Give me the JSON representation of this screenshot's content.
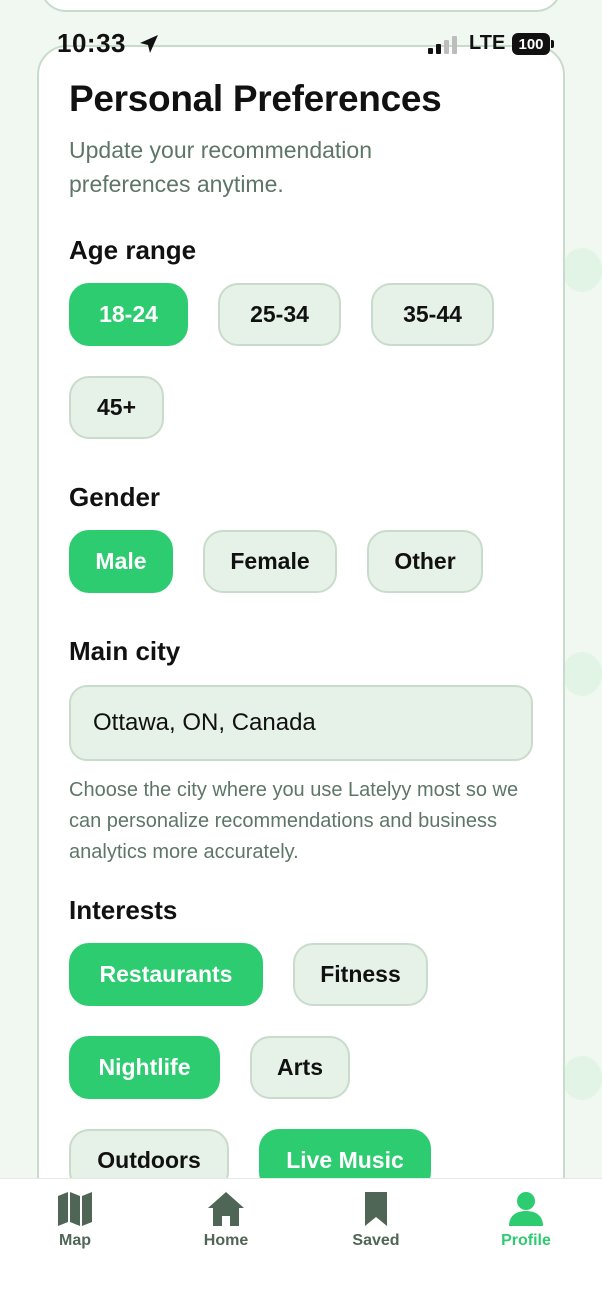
{
  "status_bar": {
    "time": "10:33",
    "network": "LTE",
    "battery": "100"
  },
  "header": {
    "title": "Personal Preferences",
    "subtitle": "Update your recommendation preferences anytime."
  },
  "age_range": {
    "label": "Age range",
    "options": [
      {
        "label": "18-24",
        "selected": true
      },
      {
        "label": "25-34",
        "selected": false
      },
      {
        "label": "35-44",
        "selected": false
      },
      {
        "label": "45+",
        "selected": false
      }
    ]
  },
  "gender": {
    "label": "Gender",
    "options": [
      {
        "label": "Male",
        "selected": true
      },
      {
        "label": "Female",
        "selected": false
      },
      {
        "label": "Other",
        "selected": false
      }
    ]
  },
  "main_city": {
    "label": "Main city",
    "value": "Ottawa, ON, Canada",
    "helper": "Choose the city where you use Latelyy most so we can personalize recommendations and business analytics more accurately."
  },
  "interests": {
    "label": "Interests",
    "options": [
      {
        "label": "Restaurants",
        "selected": true
      },
      {
        "label": "Fitness",
        "selected": false
      },
      {
        "label": "Nightlife",
        "selected": true
      },
      {
        "label": "Arts",
        "selected": false
      },
      {
        "label": "Outdoors",
        "selected": false
      },
      {
        "label": "Live Music",
        "selected": true
      }
    ]
  },
  "tab_bar": {
    "items": [
      {
        "label": "Map",
        "icon": "map-icon",
        "active": false
      },
      {
        "label": "Home",
        "icon": "home-icon",
        "active": false
      },
      {
        "label": "Saved",
        "icon": "bookmark-icon",
        "active": false
      },
      {
        "label": "Profile",
        "icon": "person-icon",
        "active": true
      }
    ]
  },
  "colors": {
    "accent": "#2ecc71",
    "chip_bg": "#e6f1e7",
    "chip_border": "#c9dccb",
    "muted_text": "#5e7668",
    "background": "#f1f7f1"
  }
}
